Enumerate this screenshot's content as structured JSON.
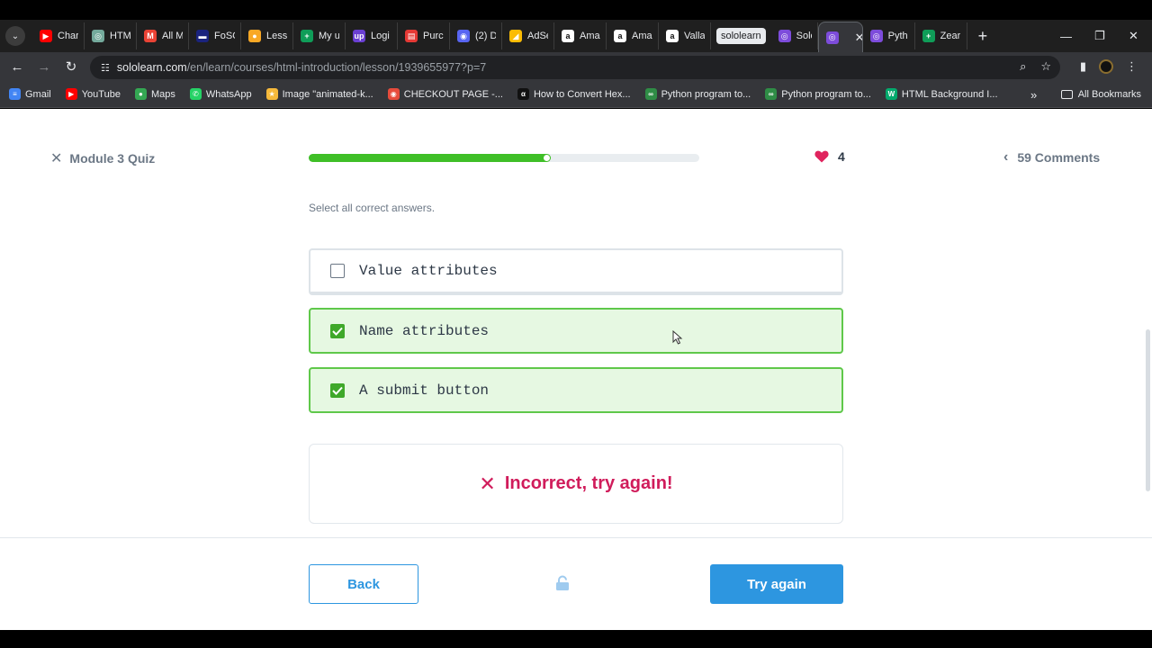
{
  "browser": {
    "tabs": [
      {
        "title": "Char",
        "icon": "youtube-icon",
        "color": "#ff0000"
      },
      {
        "title": "HTM",
        "icon": "chatgpt-icon",
        "color": "#74aa9c"
      },
      {
        "title": "All M",
        "icon": "gmail-icon",
        "color": "#ea4335"
      },
      {
        "title": "FoSC",
        "icon": "fosc-icon",
        "color": "#1a237e"
      },
      {
        "title": "Less",
        "icon": "lesson-icon",
        "color": "#f9a825"
      },
      {
        "title": "My u",
        "icon": "sheets-icon",
        "color": "#0f9d58"
      },
      {
        "title": "Logi",
        "icon": "upwork-icon",
        "color": "#6a3fd3"
      },
      {
        "title": "Purc",
        "icon": "purchase-icon",
        "color": "#e53935"
      },
      {
        "title": "(2) D",
        "icon": "discord-icon",
        "color": "#5865f2"
      },
      {
        "title": "AdSe",
        "icon": "adsense-icon",
        "color": "#fbbc04"
      },
      {
        "title": "Ama",
        "icon": "amazon-icon",
        "color": "#ffffff"
      },
      {
        "title": "Ama",
        "icon": "amazon-icon",
        "color": "#ffffff"
      },
      {
        "title": "Valla",
        "icon": "amazon-icon",
        "color": "#ffffff"
      }
    ],
    "tab_tooltip": "sololearn",
    "tabs_after": [
      {
        "title": "Solo",
        "icon": "sololearn-icon",
        "color": "#7d4cdb"
      }
    ],
    "active_tab": {
      "title": "",
      "icon": "sololearn-icon",
      "color": "#7d4cdb"
    },
    "tabs_end": [
      {
        "title": "Pyth",
        "icon": "sololearn-icon",
        "color": "#7d4cdb"
      },
      {
        "title": "Zear",
        "icon": "sheets-icon",
        "color": "#0f9d58"
      }
    ],
    "url_host": "sololearn.com",
    "url_path": "/en/learn/courses/html-introduction/lesson/1939655977?p=7",
    "bookmarks": [
      {
        "label": "Gmail",
        "icon": "google-apps-icon",
        "color": "#4285f4"
      },
      {
        "label": "YouTube",
        "icon": "youtube-icon",
        "color": "#ff0000"
      },
      {
        "label": "Maps",
        "icon": "maps-icon",
        "color": "#34a853"
      },
      {
        "label": "WhatsApp",
        "icon": "whatsapp-icon",
        "color": "#25d366"
      },
      {
        "label": "Image \"animated-k...",
        "icon": "star-icon",
        "color": "#f6b93b"
      },
      {
        "label": "CHECKOUT PAGE -...",
        "icon": "checkout-icon",
        "color": "#e74c3c"
      },
      {
        "label": "How to Convert Hex...",
        "icon": "alpha-icon",
        "color": "#111111"
      },
      {
        "label": "Python program to...",
        "icon": "gfg-icon",
        "color": "#2f8d46"
      },
      {
        "label": "Python program to...",
        "icon": "gfg-icon",
        "color": "#2f8d46"
      },
      {
        "label": "HTML Background I...",
        "icon": "w3-icon",
        "color": "#04aa6d"
      }
    ],
    "all_bookmarks": "All Bookmarks"
  },
  "quiz": {
    "module_title": "Module 3 Quiz",
    "progress": 0.62,
    "hearts": "4",
    "comments": "59 Comments",
    "instruction": "Select all correct answers.",
    "options": [
      {
        "label": "Value attributes",
        "checked": false
      },
      {
        "label": "Name attributes",
        "checked": true
      },
      {
        "label": "A submit button",
        "checked": true
      }
    ],
    "feedback": "Incorrect, try again!",
    "back_label": "Back",
    "try_again_label": "Try again"
  },
  "colors": {
    "accent": "#2d96e0",
    "progress": "#3fbf27",
    "selected_bg": "#e6f8e2",
    "selected_border": "#5fc84a",
    "error": "#d01c5b",
    "heart": "#e0245e"
  }
}
